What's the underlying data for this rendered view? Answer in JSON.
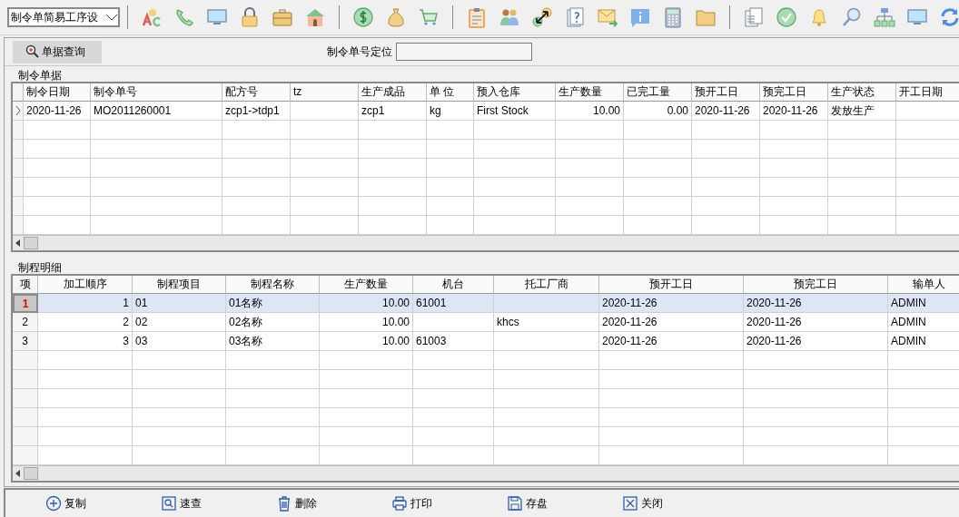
{
  "toolbar": {
    "module_select": {
      "value": "制令单简易工序设"
    }
  },
  "query_bar": {
    "search_button": "单据查询",
    "locate_label": "制令单号定位"
  },
  "orders": {
    "title": "制令单据",
    "columns": [
      {
        "label": "制令日期",
        "kind": "text"
      },
      {
        "label": "制令单号",
        "kind": "text"
      },
      {
        "label": "配方号",
        "kind": "text"
      },
      {
        "label": "tz",
        "kind": "text"
      },
      {
        "label": "生产成品",
        "kind": "text"
      },
      {
        "label": "单 位",
        "kind": "text"
      },
      {
        "label": "预入仓库",
        "kind": "text"
      },
      {
        "label": "生产数量",
        "kind": "number"
      },
      {
        "label": "已完工量",
        "kind": "number"
      },
      {
        "label": "预开工日",
        "kind": "text"
      },
      {
        "label": "预完工日",
        "kind": "text"
      },
      {
        "label": "生产状态",
        "kind": "text"
      },
      {
        "label": "开工日期",
        "kind": "text"
      }
    ],
    "rows": [
      {
        "current": true,
        "cells": [
          "2020-11-26",
          "MO2011260001",
          "zcp1->tdp1",
          null,
          "zcp1",
          "kg",
          "First Stock",
          "10.00",
          "0.00",
          "2020-11-26",
          "2020-11-26",
          "发放生产",
          null
        ]
      }
    ]
  },
  "process": {
    "title": "制程明细",
    "index_label": "项",
    "columns": [
      {
        "label": "加工顺序",
        "kind": "number"
      },
      {
        "label": "制程项目",
        "kind": "text"
      },
      {
        "label": "制程名称",
        "kind": "text"
      },
      {
        "label": "生产数量",
        "kind": "number"
      },
      {
        "label": "机台",
        "kind": "text"
      },
      {
        "label": "托工厂商",
        "kind": "text"
      },
      {
        "label": "预开工日",
        "kind": "text"
      },
      {
        "label": "预完工日",
        "kind": "text"
      },
      {
        "label": "输单人",
        "kind": "text"
      }
    ],
    "rows": [
      {
        "index": "1",
        "selected": true,
        "cells": [
          "1",
          "01",
          "01名称",
          "10.00",
          "61001",
          null,
          "2020-11-26",
          "2020-11-26",
          "ADMIN"
        ]
      },
      {
        "index": "2",
        "selected": false,
        "cells": [
          "2",
          "02",
          "02名称",
          "10.00",
          null,
          "khcs",
          "2020-11-26",
          "2020-11-26",
          "ADMIN"
        ]
      },
      {
        "index": "3",
        "selected": false,
        "cells": [
          "3",
          "03",
          "03名称",
          "10.00",
          "61003",
          null,
          "2020-11-26",
          "2020-11-26",
          "ADMIN"
        ]
      }
    ]
  },
  "footer": {
    "buttons": [
      {
        "label": "复制",
        "kind": "copy"
      },
      {
        "label": "速查",
        "kind": "quick-search"
      },
      {
        "label": "删除",
        "kind": "delete"
      },
      {
        "label": "打印",
        "kind": "print"
      },
      {
        "label": "存盘",
        "kind": "save"
      },
      {
        "label": "关闭",
        "kind": "close"
      }
    ]
  }
}
